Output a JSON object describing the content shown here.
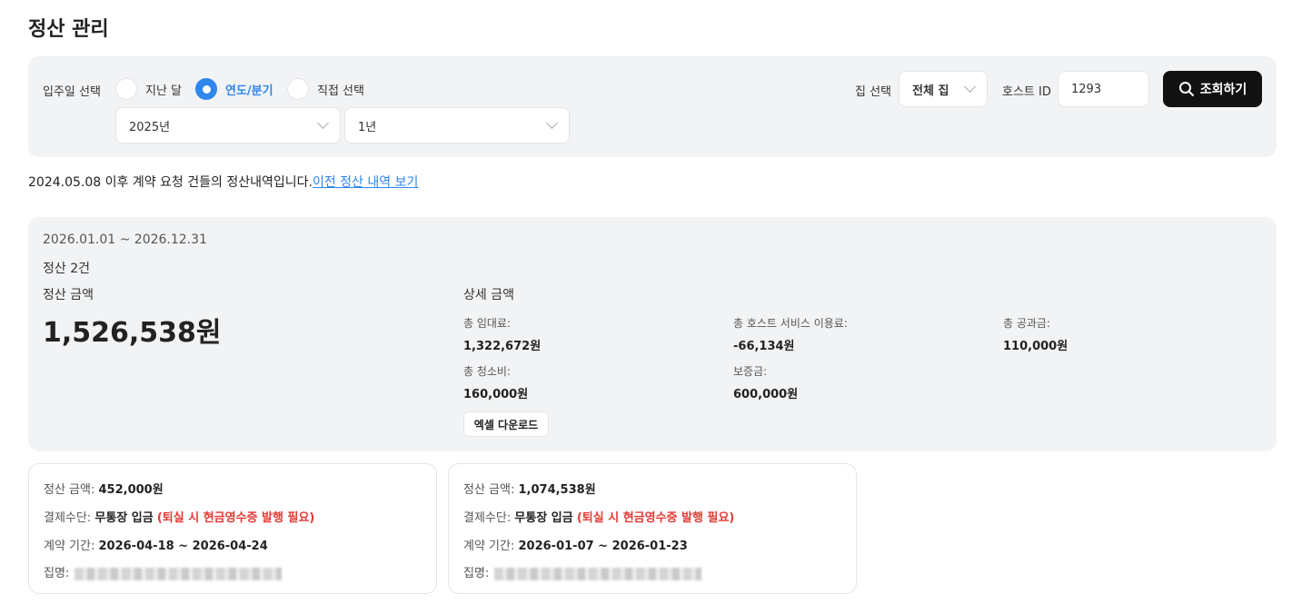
{
  "page": {
    "title": "정산 관리"
  },
  "filter": {
    "checkin_label": "입주일 선택",
    "radios": [
      {
        "label": "지난 달",
        "checked": false
      },
      {
        "label": "연도/분기",
        "checked": true
      },
      {
        "label": "직접 선택",
        "checked": false
      }
    ],
    "year_select": "2025년",
    "period_select": "1년",
    "house_label": "집 선택",
    "house_select": "전체 집",
    "host_id_label": "호스트 ID",
    "host_id_value": "1293",
    "search_label": "조회하기"
  },
  "notice": {
    "text": "2024.05.08 이후 계약 요청 건들의 정산내역입니다.",
    "link": "이전 정산 내역 보기"
  },
  "summary": {
    "period": "2026.01.01 ~ 2026.12.31",
    "count": "정산 2건",
    "amount_label": "정산 금액",
    "amount": "1,526,538원",
    "detail_title": "상세 금액",
    "details": [
      {
        "label": "총 임대료:",
        "value": "1,322,672원"
      },
      {
        "label": "총 호스트 서비스 이용료:",
        "value": "-66,134원"
      },
      {
        "label": "총 공과금:",
        "value": "110,000원"
      },
      {
        "label": "총 청소비:",
        "value": "160,000원"
      },
      {
        "label": "보증금:",
        "value": "600,000원"
      }
    ],
    "excel_label": "엑셀 다운로드"
  },
  "cards": [
    {
      "amount_label": "정산 금액:",
      "amount": "452,000원",
      "payment_label": "결제수단:",
      "payment": "무통장 입금",
      "payment_note": "(퇴실 시 현금영수증 발행 필요)",
      "period_label": "계약 기간:",
      "period": "2026-04-18 ~ 2026-04-24",
      "house_label": "집명:"
    },
    {
      "amount_label": "정산 금액:",
      "amount": "1,074,538원",
      "payment_label": "결제수단:",
      "payment": "무통장 입금",
      "payment_note": "(퇴실 시 현금영수증 발행 필요)",
      "period_label": "계약 기간:",
      "period": "2026-01-07 ~ 2026-01-23",
      "house_label": "집명:"
    }
  ],
  "colors": {
    "accent": "#2f86eb",
    "warning": "#e53935",
    "panel": "#f1f3f5",
    "button": "#111111"
  }
}
